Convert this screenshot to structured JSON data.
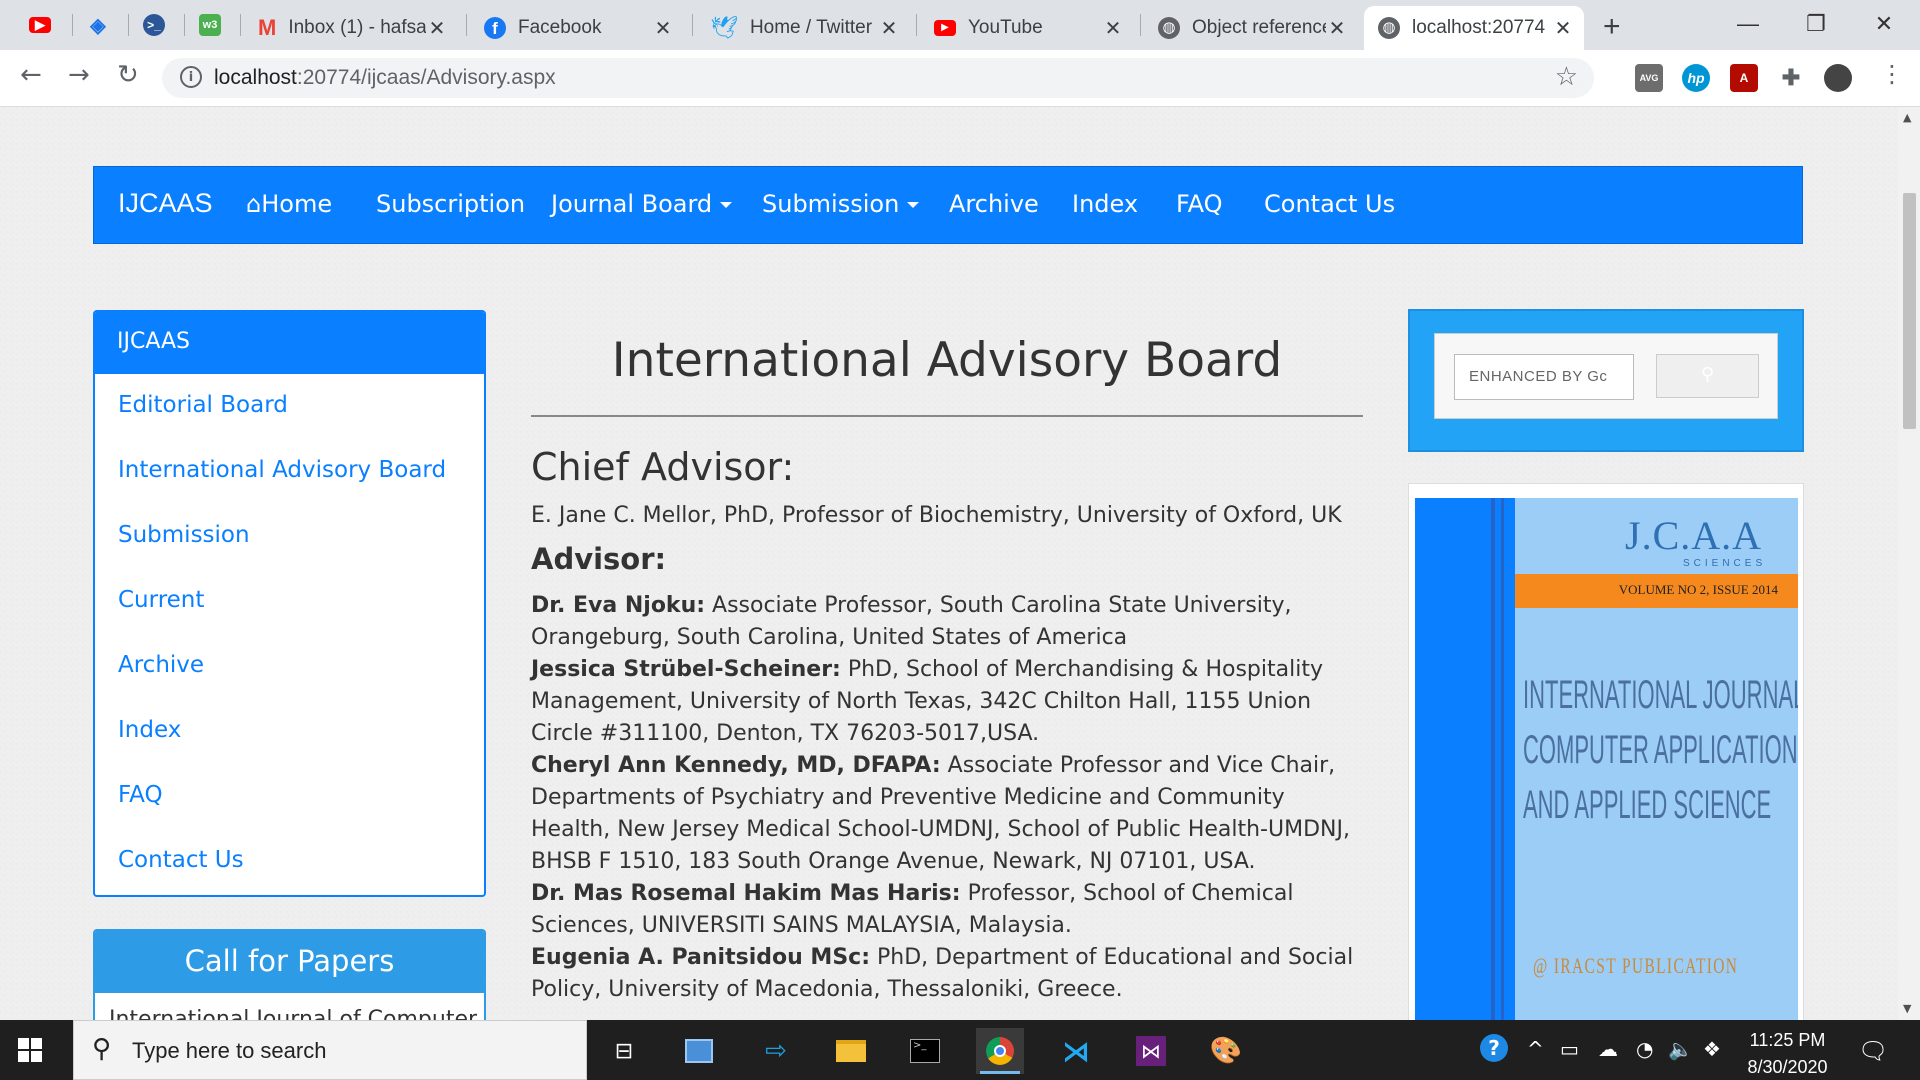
{
  "browser": {
    "pinned_tabs": [
      {
        "icon": "youtube-icon",
        "color": "#ff0000"
      },
      {
        "icon": "layers-icon",
        "color": "#1a73e8"
      },
      {
        "icon": "terminal-icon",
        "color": "#2b5797"
      },
      {
        "icon": "w3-icon",
        "color": "#4caf50"
      }
    ],
    "tabs": [
      {
        "title": "Inbox (1) - hafsa",
        "icon": "gmail-icon",
        "color": "#ea4335"
      },
      {
        "title": "Facebook",
        "icon": "facebook-icon",
        "color": "#1877f2"
      },
      {
        "title": "Home / Twitter",
        "icon": "twitter-icon",
        "color": "#1da1f2"
      },
      {
        "title": "YouTube",
        "icon": "youtube-icon",
        "color": "#ff0000"
      },
      {
        "title": "Object reference",
        "icon": "globe-icon",
        "color": "#5f6368"
      },
      {
        "title": "localhost:20774",
        "icon": "globe-icon",
        "color": "#5f6368"
      }
    ],
    "url_host": "localhost",
    "url_rest": ":20774/ijcaas/Advisory.aspx",
    "extensions": [
      {
        "name": "avg-icon",
        "label": "AVG",
        "color": "#6d6d6d"
      },
      {
        "name": "hp-icon",
        "label": "hp",
        "color": "#0096d6"
      },
      {
        "name": "pdf-icon",
        "label": "A",
        "color": "#b30b00"
      },
      {
        "name": "puzzle-icon",
        "label": "✚",
        "color": "#5f6368"
      }
    ]
  },
  "nav": {
    "brand": "IJCAAS",
    "home": "Home",
    "subscription": "Subscription",
    "journal_board": "Journal Board",
    "submission": "Submission",
    "archive": "Archive",
    "index": "Index",
    "faq": "FAQ",
    "contact": "Contact Us"
  },
  "sidebar": {
    "title": "IJCAAS",
    "links": [
      "Editorial Board",
      "International Advisory Board",
      "Submission",
      "Current",
      "Archive",
      "Index",
      "FAQ",
      "Contact Us"
    ]
  },
  "call_for_papers": {
    "title": "Call for Papers",
    "body": "International Journal of Computer"
  },
  "content": {
    "title": "International Advisory Board",
    "chief_heading": "Chief Advisor:",
    "chief_name": "E. Jane C. Mellor, PhD, Professor of Biochemistry, University of Oxford, UK",
    "advisor_heading": "Advisor:",
    "advisors": [
      {
        "name": "Dr. Eva Njoku:",
        "details": " Associate Professor, South Carolina State University, Orangeburg, South Carolina, United States of America"
      },
      {
        "name": "Jessica Strübel-Scheiner:",
        "details": " PhD, School of Merchandising & Hospitality Management, University of North Texas, 342C Chilton Hall, 1155 Union Circle #311100, Denton, TX 76203-5017,USA."
      },
      {
        "name": "Cheryl Ann Kennedy, MD, DFAPA:",
        "details": " Associate Professor and Vice Chair, Departments of Psychiatry and Preventive Medicine and Community Health, New Jersey Medical School-UMDNJ, School of Public Health-UMDNJ, BHSB F 1510, 183 South Orange Avenue, Newark, NJ 07101, USA."
      },
      {
        "name": "Dr. Mas Rosemal Hakim Mas Haris:",
        "details": " Professor, School of Chemical Sciences, UNIVERSITI SAINS MALAYSIA, Malaysia."
      },
      {
        "name": "Eugenia A. Panitsidou MSc:",
        "details": " PhD, Department of Educational and Social Policy, University of Macedonia, Thessaloniki, Greece."
      }
    ]
  },
  "search": {
    "placeholder": "ENHANCED BY Gc"
  },
  "cover": {
    "logo": "J.C.A.A",
    "logo_sub": "SCIENCES",
    "volume": "VOLUME NO 2, ISSUE 2014",
    "journal_line1": "INTERNATIONAL JOURNAL OF",
    "journal_line2": "COMPUTER APPLICATION",
    "journal_line3": "AND APPLIED SCIENCE",
    "publisher": "@ IRACST PUBLICATION"
  },
  "taskbar": {
    "search_placeholder": "Type here to search",
    "time": "11:25 PM",
    "date": "8/30/2020"
  }
}
